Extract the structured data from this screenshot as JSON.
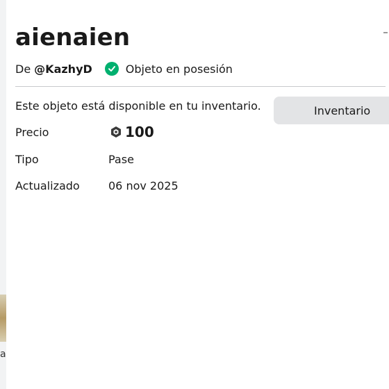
{
  "item": {
    "title": "aienaien",
    "by_prefix": "De",
    "creator": "@KazhyD",
    "owned_status": "Objeto en posesión",
    "availability": "Este objeto está disponible en tu inventario.",
    "inventory_button": "Inventario"
  },
  "details": {
    "price_label": "Precio",
    "price_value": "100",
    "type_label": "Tipo",
    "type_value": "Pase",
    "updated_label": "Actualizado",
    "updated_value": "06 nov 2025"
  },
  "icons": {
    "owned": "check-circle-icon",
    "currency": "robux-icon"
  },
  "colors": {
    "owned_green": "#00b06f",
    "button_bg": "#e3e4e6"
  },
  "sidebar_edge_glyph": "a"
}
